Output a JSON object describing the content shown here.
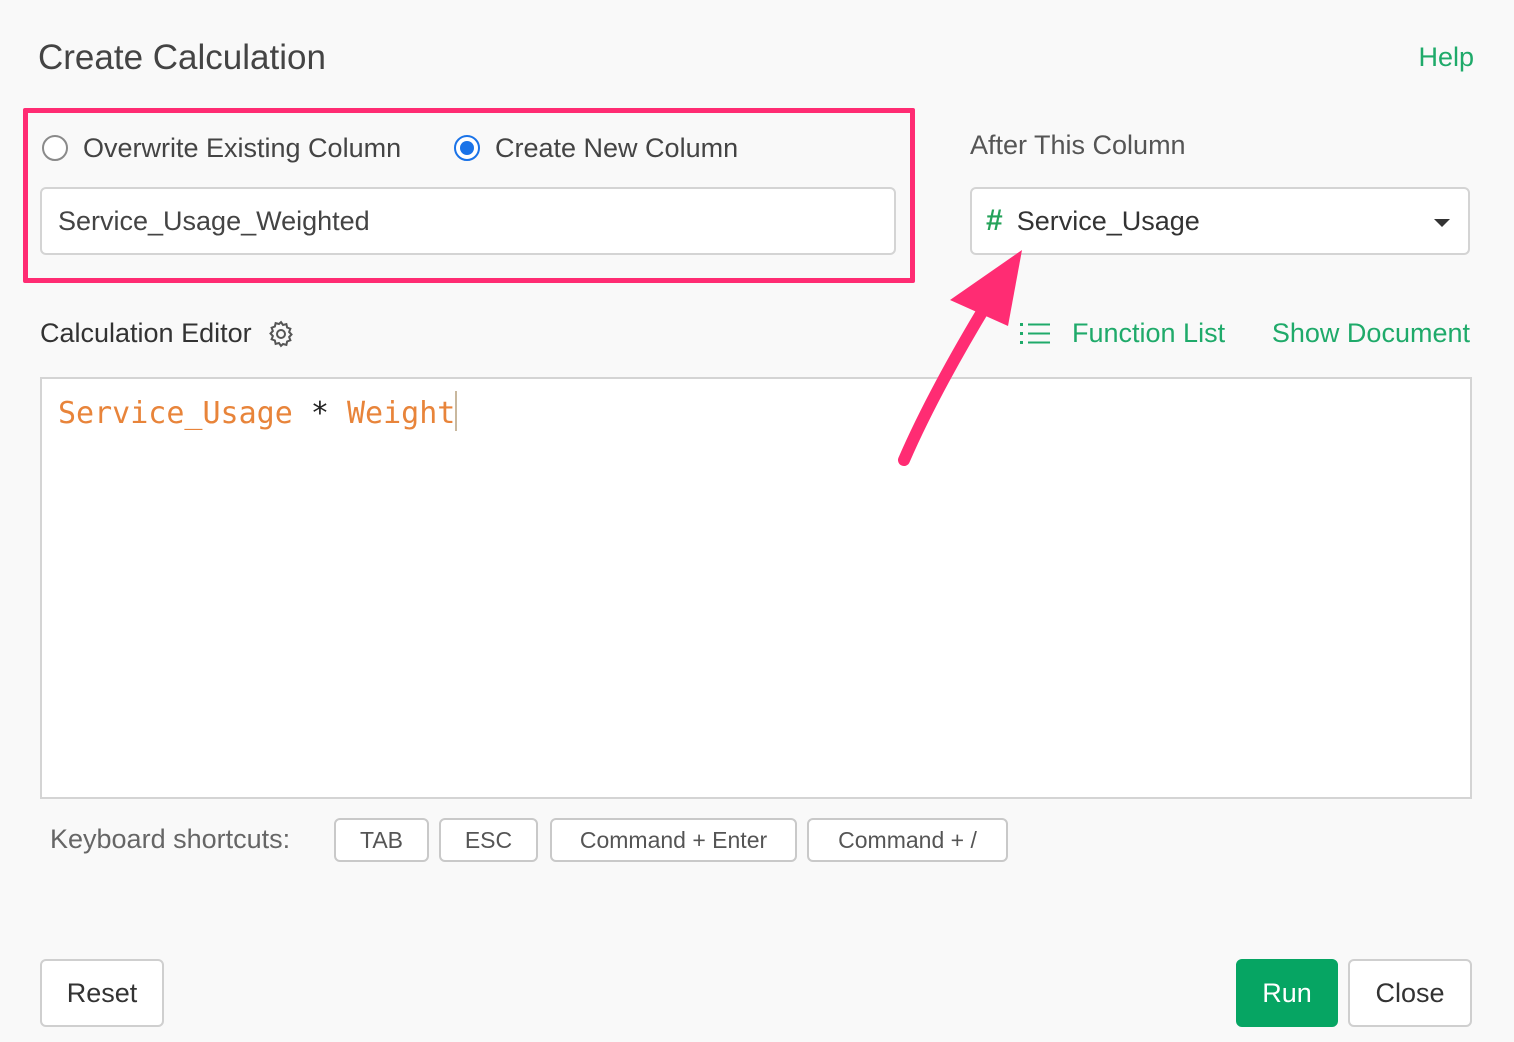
{
  "dialog": {
    "title": "Create Calculation",
    "help_label": "Help"
  },
  "target": {
    "options": [
      {
        "label": "Overwrite Existing Column",
        "selected": false
      },
      {
        "label": "Create New Column",
        "selected": true
      }
    ],
    "new_column_name": "Service_Usage_Weighted"
  },
  "position": {
    "label": "After This Column",
    "selected_column": "Service_Usage",
    "column_type_icon": "number-hash-icon"
  },
  "editor": {
    "label": "Calculation Editor",
    "function_list_label": "Function List",
    "show_document_label": "Show Document",
    "expression_tokens": [
      {
        "text": "Service_Usage",
        "kind": "column"
      },
      {
        "text": " * ",
        "kind": "operator"
      },
      {
        "text": "Weight",
        "kind": "column"
      }
    ]
  },
  "shortcuts": {
    "label": "Keyboard shortcuts:",
    "keys": [
      "TAB",
      "ESC",
      "Command + Enter",
      "Command + /"
    ]
  },
  "footer": {
    "reset_label": "Reset",
    "run_label": "Run",
    "close_label": "Close"
  },
  "colors": {
    "accent_green": "#1faa6a",
    "run_button": "#06a563",
    "highlight_pink": "#ff2c73",
    "radio_blue": "#1a73e8",
    "column_token": "#e8843a"
  }
}
